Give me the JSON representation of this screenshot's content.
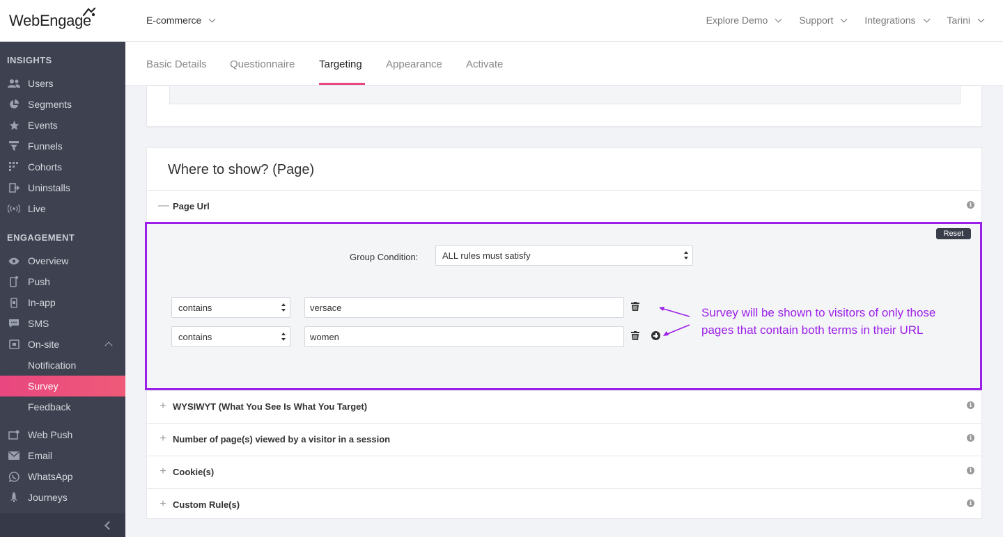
{
  "brand": {
    "logo_text": "WebEngage",
    "accent": "#e8477f",
    "highlight": "#9b1fe8"
  },
  "header": {
    "workspace": "E-commerce",
    "nav": [
      "Explore Demo",
      "Support",
      "Integrations",
      "Tarini"
    ]
  },
  "sidebar": {
    "insights_title": "INSIGHTS",
    "insights": [
      {
        "label": "Users",
        "icon": "users-icon"
      },
      {
        "label": "Segments",
        "icon": "pie-chart-icon"
      },
      {
        "label": "Events",
        "icon": "star-icon"
      },
      {
        "label": "Funnels",
        "icon": "funnel-icon"
      },
      {
        "label": "Cohorts",
        "icon": "grid-icon"
      },
      {
        "label": "Uninstalls",
        "icon": "uninstall-icon"
      },
      {
        "label": "Live",
        "icon": "broadcast-icon"
      }
    ],
    "engagement_title": "ENGAGEMENT",
    "engagement": [
      {
        "label": "Overview",
        "icon": "eye-icon"
      },
      {
        "label": "Push",
        "icon": "mobile-push-icon"
      },
      {
        "label": "In-app",
        "icon": "mobile-icon"
      },
      {
        "label": "SMS",
        "icon": "sms-icon"
      },
      {
        "label": "On-site",
        "icon": "onsite-icon"
      }
    ],
    "onsite_sub": [
      "Notification",
      "Survey",
      "Feedback"
    ],
    "channels": [
      {
        "label": "Web Push",
        "icon": "web-push-icon"
      },
      {
        "label": "Email",
        "icon": "email-icon"
      },
      {
        "label": "WhatsApp",
        "icon": "whatsapp-icon"
      },
      {
        "label": "Journeys",
        "icon": "rocket-icon"
      }
    ]
  },
  "tabs": [
    "Basic Details",
    "Questionnaire",
    "Targeting",
    "Appearance",
    "Activate"
  ],
  "active_tab": "Targeting",
  "section": {
    "title": "Where to show? (Page)",
    "page_url_label": "Page Url",
    "reset_label": "Reset",
    "group_condition_label": "Group Condition:",
    "group_condition_value": "ALL rules must satisfy",
    "rules": [
      {
        "operator": "contains",
        "value": "versace"
      },
      {
        "operator": "contains",
        "value": "women"
      }
    ],
    "collapsed": [
      "WYSIWYT (What You See Is What You Target)",
      "Number of page(s) viewed by a visitor in a session",
      "Cookie(s)",
      "Custom Rule(s)"
    ]
  },
  "annotation": "Survey will be shown to visitors of only those pages that contain both terms in their URL"
}
